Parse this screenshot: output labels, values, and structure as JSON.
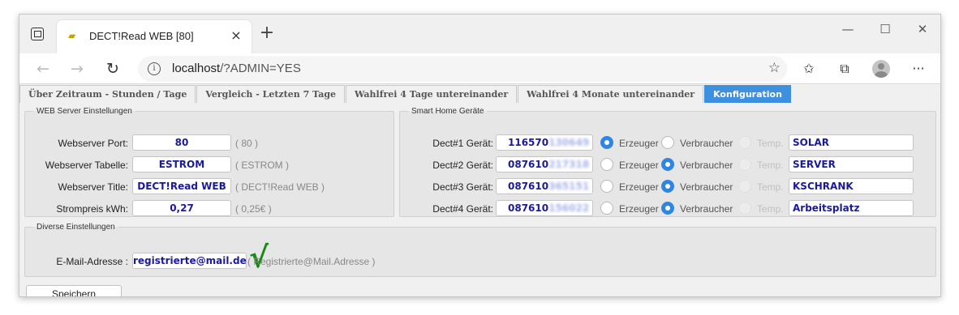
{
  "browser": {
    "tab_title": "DECT!Read WEB [80]",
    "tab_close": "×",
    "new_tab": "+",
    "url_host": "localhost",
    "url_rest": "/?ADMIN=YES"
  },
  "app_tabs": [
    "Über Zeitraum - Stunden / Tage",
    "Vergleich - Letzten 7 Tage",
    "Wahlfrei 4 Tage untereinander",
    "Wahlfrei 4 Monate untereinander",
    "Konfiguration"
  ],
  "web_server": {
    "legend": "WEB Server Einstellungen",
    "rows": [
      {
        "label": "Webserver Port:",
        "value": "80",
        "hint": "( 80 )"
      },
      {
        "label": "Webserver Tabelle:",
        "value": "ESTROM",
        "hint": "( ESTROM )"
      },
      {
        "label": "Webserver Title:",
        "value": "DECT!Read WEB",
        "hint": "( DECT!Read WEB )"
      },
      {
        "label": "Strompreis kWh:",
        "value": "0,27",
        "hint": "( 0,25€ )"
      }
    ]
  },
  "smart_home": {
    "legend": "Smart Home Geräte",
    "erzeuger_label": "Erzeuger",
    "verbraucher_label": "Verbraucher",
    "temp_label": "Temp.",
    "devices": [
      {
        "label": "Dect#1 Gerät:",
        "id_visible": "116570",
        "id_hidden": "130649",
        "mode": "erzeuger",
        "name": "SOLAR"
      },
      {
        "label": "Dect#2 Gerät:",
        "id_visible": "087610",
        "id_hidden": "217318",
        "mode": "verbraucher",
        "name": "SERVER"
      },
      {
        "label": "Dect#3 Gerät:",
        "id_visible": "087610",
        "id_hidden": "365151",
        "mode": "verbraucher",
        "name": "KSCHRANK"
      },
      {
        "label": "Dect#4 Gerät:",
        "id_visible": "087610",
        "id_hidden": "156022",
        "mode": "verbraucher",
        "name": "Arbeitsplatz"
      }
    ]
  },
  "diverse": {
    "legend": "Diverse Einstellungen",
    "email_label": "E-Mail-Adresse :",
    "email_value": "registrierte@mail.de",
    "valid_mark": "√",
    "email_hint": "( Registrierte@Mail.Adresse )"
  },
  "save_label": "Speichern"
}
